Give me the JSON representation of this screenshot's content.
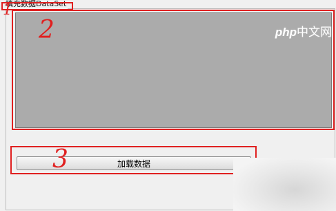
{
  "group": {
    "title": "填充数据DataSet"
  },
  "grid": {
    "label": ""
  },
  "load_button": {
    "label": "加载数据"
  },
  "annotations": {
    "one": "1",
    "two": "2",
    "three": "3"
  },
  "watermark": {
    "brand": "php",
    "site": "中文网"
  },
  "colors": {
    "annotation": "#e02020",
    "grid_bg": "#ababab",
    "window_bg": "#f0f0f0"
  }
}
